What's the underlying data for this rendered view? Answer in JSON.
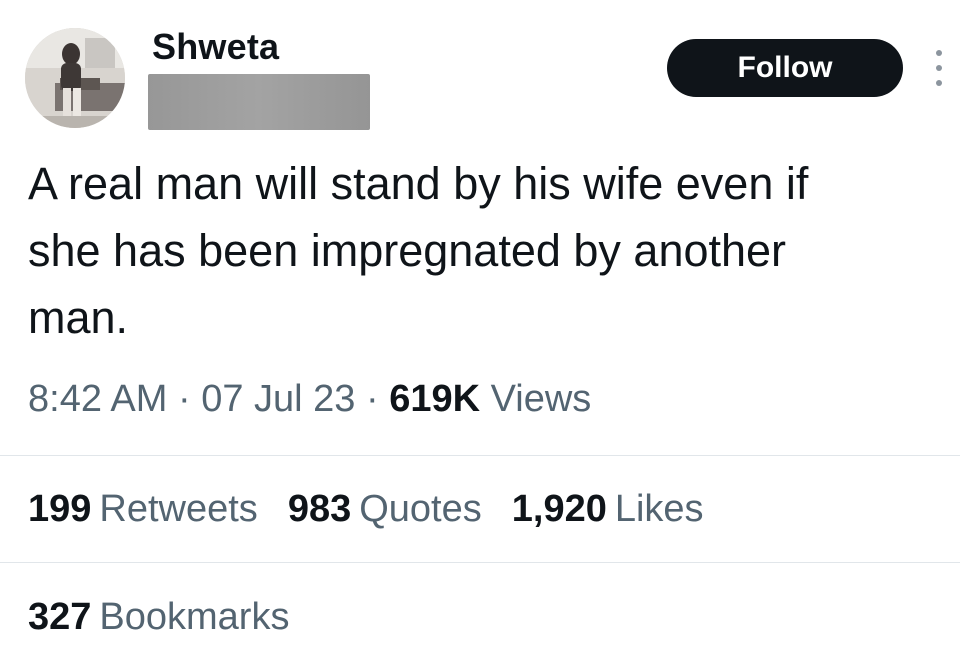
{
  "author": {
    "display_name": "Shweta",
    "avatar": "profile-photo"
  },
  "follow_label": "Follow",
  "more_icon": "more-options-icon",
  "tweet": {
    "text": "A real man will stand by his wife even if\nshe has been impregnated by another\nman.",
    "time": "8:42 AM",
    "date": "07 Jul 23",
    "separator": "·",
    "views_count": "619K",
    "views_label": "Views"
  },
  "stats": {
    "retweets": {
      "count": "199",
      "label": "Retweets"
    },
    "quotes": {
      "count": "983",
      "label": "Quotes"
    },
    "likes": {
      "count": "1,920",
      "label": "Likes"
    },
    "bookmarks": {
      "count": "327",
      "label": "Bookmarks"
    }
  },
  "colors": {
    "text_primary": "#0f1419",
    "text_secondary": "#536471",
    "button_bg": "#0f1419",
    "divider": "#e1e6ea",
    "redaction": "#9a9a9a"
  }
}
